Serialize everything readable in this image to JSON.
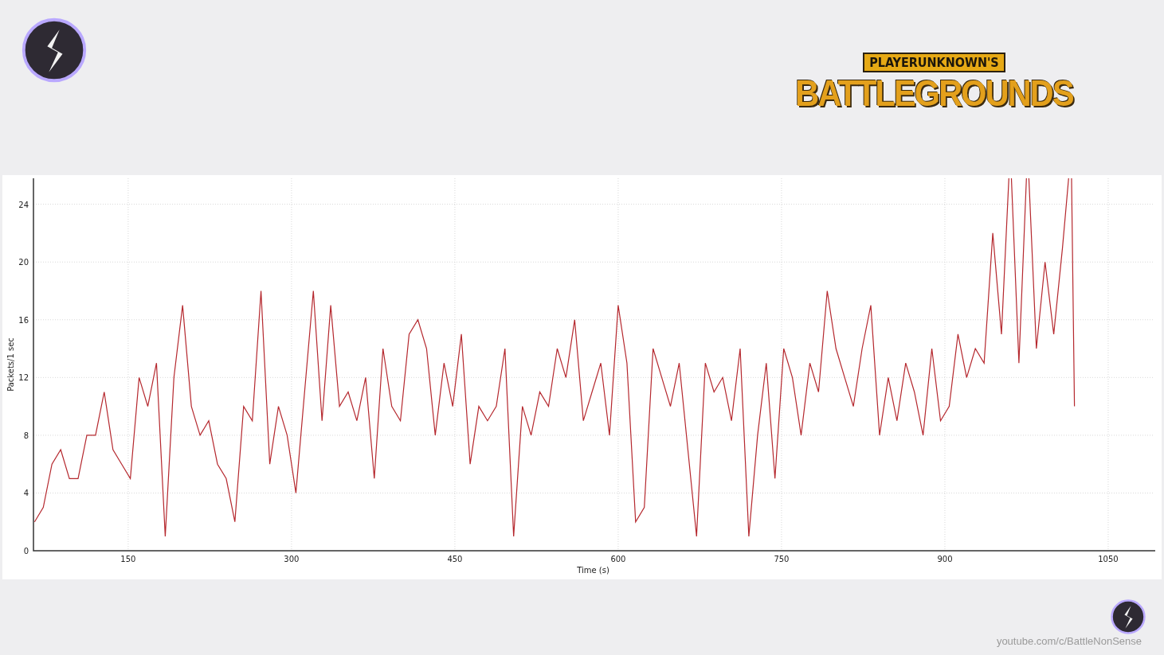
{
  "header": {
    "game_logo": {
      "line_1": "PLAYERUNKNOWN'S",
      "line_2": "BATTLEGROUNDS"
    }
  },
  "graph": {
    "chart_data": {
      "type": "line",
      "grid": true,
      "xlabel": "Time (s)",
      "ylabel": "Packets/1 sec",
      "xlim": [
        63,
        1091
      ],
      "ylim": [
        0,
        25.8
      ],
      "xticks": [
        150,
        300,
        450,
        600,
        750,
        900,
        1050
      ],
      "yticks": [
        0,
        4,
        8,
        12,
        16,
        20,
        24
      ],
      "x": [
        64,
        72,
        80,
        88,
        96,
        104,
        112,
        120,
        128,
        136,
        144,
        152,
        160,
        168,
        176,
        184,
        192,
        200,
        208,
        216,
        224,
        232,
        240,
        248,
        256,
        264,
        272,
        280,
        288,
        296,
        304,
        312,
        320,
        328,
        336,
        344,
        352,
        360,
        368,
        376,
        384,
        392,
        400,
        408,
        416,
        424,
        432,
        440,
        448,
        456,
        464,
        472,
        480,
        488,
        496,
        504,
        512,
        520,
        528,
        536,
        544,
        552,
        560,
        568,
        576,
        584,
        592,
        600,
        608,
        616,
        624,
        632,
        640,
        648,
        656,
        664,
        672,
        680,
        688,
        696,
        704,
        712,
        720,
        728,
        736,
        744,
        752,
        760,
        768,
        776,
        784,
        792,
        800,
        808,
        816,
        824,
        832,
        840,
        848,
        856,
        864,
        872,
        880,
        888,
        896,
        904,
        912,
        920,
        928,
        936,
        944,
        952,
        960,
        968,
        976,
        984,
        992,
        1000,
        1008,
        1016,
        1019
      ],
      "series": [
        {
          "color": "#b5282e",
          "values": [
            2,
            3,
            6,
            7,
            5,
            5,
            8,
            8,
            11,
            7,
            6,
            5,
            12,
            10,
            13,
            1,
            12,
            17,
            10,
            8,
            9,
            6,
            5,
            2,
            10,
            9,
            18,
            6,
            10,
            8,
            4,
            11,
            18,
            9,
            17,
            10,
            11,
            9,
            12,
            5,
            14,
            10,
            9,
            15,
            16,
            14,
            8,
            13,
            10,
            15,
            6,
            10,
            9,
            10,
            14,
            1,
            10,
            8,
            11,
            10,
            14,
            12,
            16,
            9,
            11,
            13,
            8,
            17,
            13,
            2,
            3,
            14,
            12,
            10,
            13,
            7,
            1,
            13,
            11,
            12,
            9,
            14,
            1,
            8,
            13,
            5,
            14,
            12,
            8,
            13,
            11,
            18,
            14,
            12,
            10,
            14,
            17,
            8,
            12,
            9,
            13,
            11,
            8,
            14,
            9,
            10,
            15,
            12,
            14,
            13,
            22,
            15,
            null,
            13,
            null,
            14,
            20,
            15,
            21,
            null,
            10
          ]
        }
      ]
    }
  },
  "footer": {
    "channel_url": "youtube.com/c/BattleNonSense"
  }
}
